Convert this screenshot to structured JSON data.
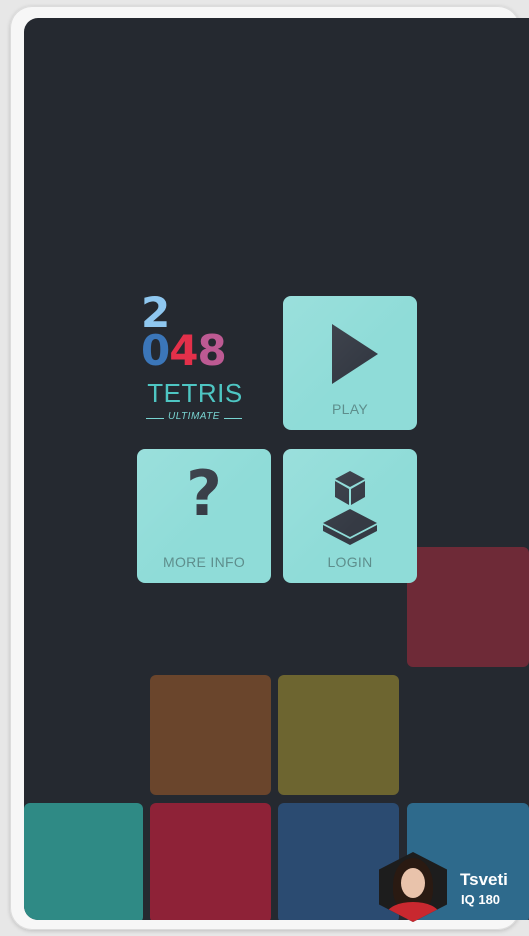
{
  "logo": {
    "digit_2": "2",
    "digit_0": "0",
    "digit_4": "4",
    "digit_8": "8",
    "title": "TETRIS",
    "subtitle": "ULTIMATE"
  },
  "menu": {
    "play_label": "PLAY",
    "more_info_label": "MORE INFO",
    "more_info_symbol": "?",
    "login_label": "LOGIN"
  },
  "user": {
    "name": "Tsveti",
    "iq": "IQ 180"
  },
  "colors": {
    "background": "#252930",
    "tile": "#8fdcd8",
    "block_red": "#6e2a37",
    "block_orange": "#6a452c",
    "block_olive": "#6d6530",
    "block_teal": "#2f8a85",
    "block_crimson": "#8e2237",
    "block_blue": "#2b4b71"
  }
}
